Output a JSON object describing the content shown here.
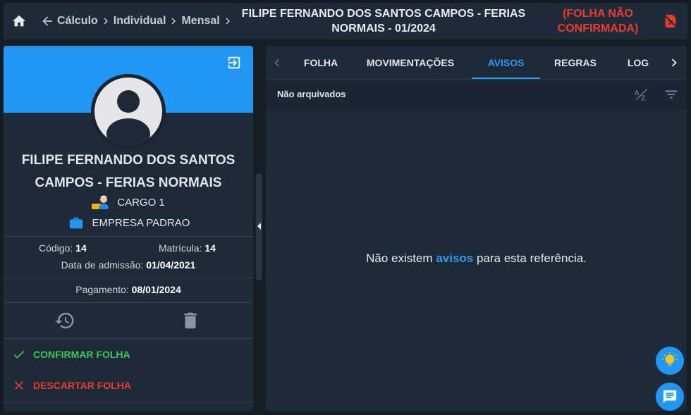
{
  "header": {
    "breadcrumb": [
      "Cálculo",
      "Individual",
      "Mensal"
    ],
    "title": "FILIPE FERNANDO DOS SANTOS CAMPOS - FERIAS NORMAIS - 01/2024",
    "status": "(FOLHA NÃO CONFIRMADA)"
  },
  "employee": {
    "name": "FILIPE FERNANDO DOS SANTOS CAMPOS - FERIAS NORMAIS",
    "role": "CARGO 1",
    "company": "EMPRESA PADRAO",
    "codigo_label": "Código:",
    "codigo": "14",
    "matricula_label": "Matrícula:",
    "matricula": "14",
    "admissao_label": "Data de admissão:",
    "admissao": "01/04/2021",
    "pagamento_label": "Pagamento:",
    "pagamento": "08/01/2024"
  },
  "actions": {
    "confirm": "CONFIRMAR FOLHA",
    "discard": "DESCARTAR FOLHA"
  },
  "tabs": [
    "FOLHA",
    "MOVIMENTAÇÕES",
    "AVISOS",
    "REGRAS",
    "LOG"
  ],
  "active_tab": "AVISOS",
  "filter": {
    "label": "Não arquivados"
  },
  "empty": {
    "prefix": "Não existem",
    "highlight": "avisos",
    "suffix": "para esta referência."
  },
  "colors": {
    "accent": "#2196f3",
    "danger": "#ee3b2f",
    "success": "#3cc85a",
    "panel": "#1f2a38",
    "background": "#141c26"
  }
}
